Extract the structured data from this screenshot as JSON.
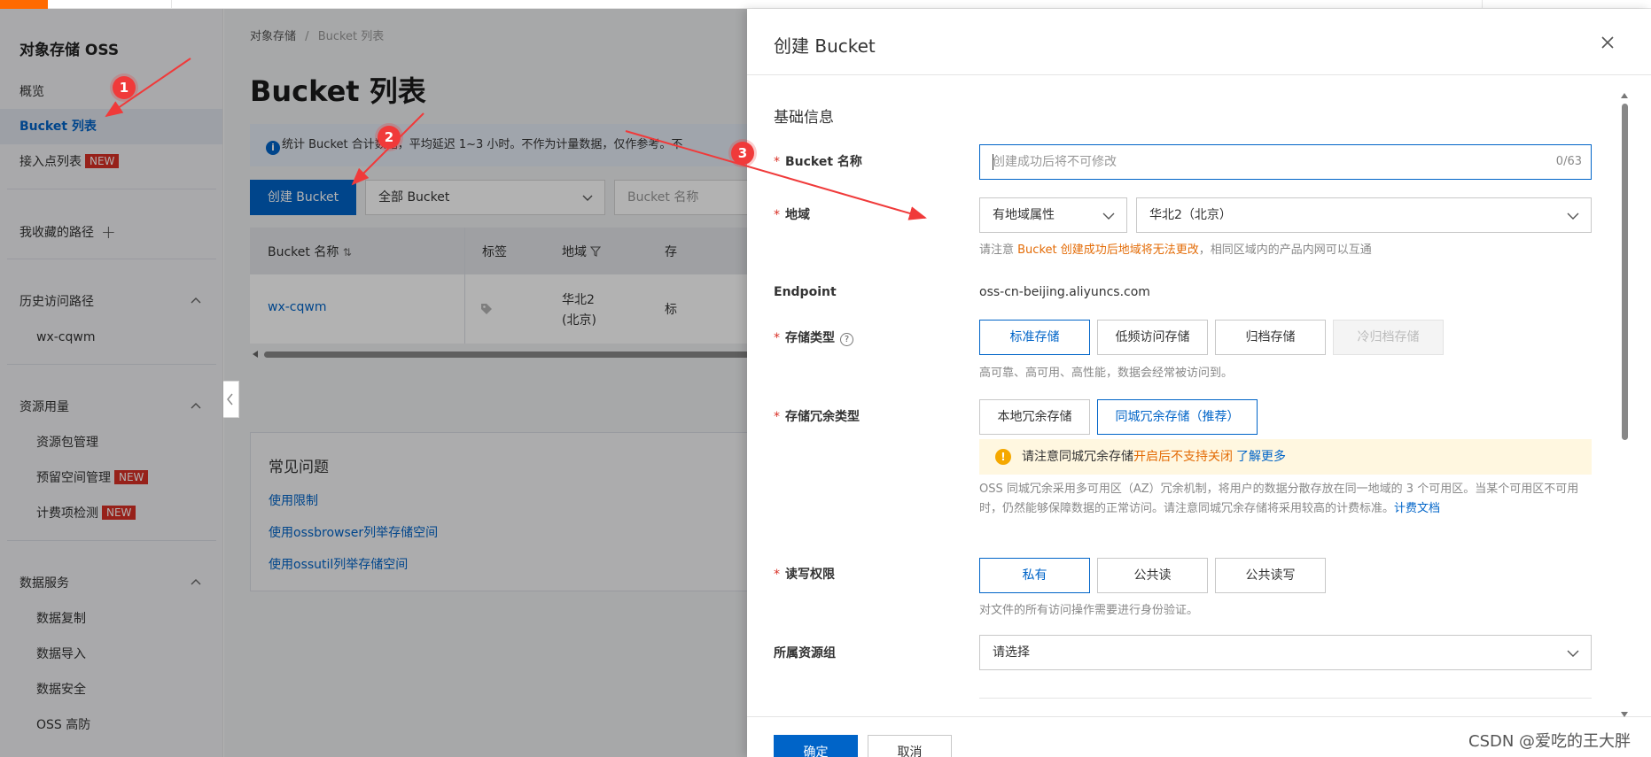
{
  "sidebar": {
    "title": "对象存储 OSS",
    "items": {
      "overview": "概览",
      "bucket_list": "Bucket 列表",
      "access_points": "接入点列表",
      "favorites": "我收藏的路径",
      "history": "历史访问路径",
      "history_bucket": "wx-cqwm",
      "resources": "资源用量",
      "package_mgmt": "资源包管理",
      "reserved_space": "预留空间管理",
      "billing_check": "计费项检测",
      "data_services": "数据服务",
      "data_replication": "数据复制",
      "data_import": "数据导入",
      "data_security": "数据安全",
      "oss_ddos": "OSS 高防"
    },
    "new_badge": "NEW"
  },
  "main": {
    "breadcrumb_root": "对象存储",
    "breadcrumb_sep": "/",
    "breadcrumb_current": "Bucket 列表",
    "page_title": "Bucket 列表",
    "notice": "统计 Bucket 合计数据，平均延迟 1~3 小时。不作为计量数据，仅作参考。不",
    "create_button": "创建 Bucket",
    "filter_select": "全部 Bucket",
    "search_placeholder": "Bucket 名称",
    "table": {
      "headers": [
        "Bucket 名称",
        "标签",
        "地域",
        "存"
      ],
      "row": {
        "name": "wx-cqwm",
        "region_line1": "华北2",
        "region_line2": "(北京)",
        "extra": "标"
      }
    },
    "faq": {
      "title": "常见问题",
      "links": [
        "使用限制",
        "使用ossbrowser列举存储空间",
        "使用ossutil列举存储空间"
      ]
    }
  },
  "drawer": {
    "title": "创建 Bucket",
    "section": "基础信息",
    "bucket_name_label": "Bucket 名称",
    "bucket_name_placeholder": "创建成功后将不可修改",
    "bucket_name_counter": "0/63",
    "region_label": "地域",
    "region_attr": "有地域属性",
    "region_value": "华北2（北京）",
    "region_hint_prefix": "请注意 ",
    "region_hint_warn": "Bucket 创建成功后地域将无法更改",
    "region_hint_suffix": "，相同区域内的产品内网可以互通",
    "endpoint_label": "Endpoint",
    "endpoint_value": "oss-cn-beijing.aliyuncs.com",
    "storage_class_label": "存储类型",
    "storage_classes": [
      "标准存储",
      "低频访问存储",
      "归档存储",
      "冷归档存储"
    ],
    "storage_class_hint": "高可靠、高可用、高性能，数据会经常被访问到。",
    "redundancy_label": "存储冗余类型",
    "redundancy_options": [
      "本地冗余存储",
      "同城冗余存储（推荐）"
    ],
    "alert_prefix": "请注意同城冗余存储",
    "alert_warn": "开启后不支持关闭",
    "alert_link": "了解更多",
    "redundancy_desc": "OSS 同城冗余采用多可用区（AZ）冗余机制，将用户的数据分散存放在同一地域的 3 个可用区。当某个可用区不可用时，仍然能够保障数据的正常访问。请注意同城冗余存储将采用较高的计费标准。",
    "redundancy_desc_link": "计费文档",
    "acl_label": "读写权限",
    "acl_options": [
      "私有",
      "公共读",
      "公共读写"
    ],
    "acl_hint": "对文件的所有访问操作需要进行身份验证。",
    "resource_group_label": "所属资源组",
    "resource_group_placeholder": "请选择",
    "ok_button": "确定",
    "cancel_button": "取消"
  },
  "annotations": [
    "1",
    "2",
    "3"
  ],
  "watermark": "CSDN @爱吃的王大胖",
  "colors": {
    "accent": "#0064c8",
    "warning": "#e36b06",
    "danger": "#d93026",
    "brand": "#ff6a00",
    "annotation": "#f03a3a"
  }
}
